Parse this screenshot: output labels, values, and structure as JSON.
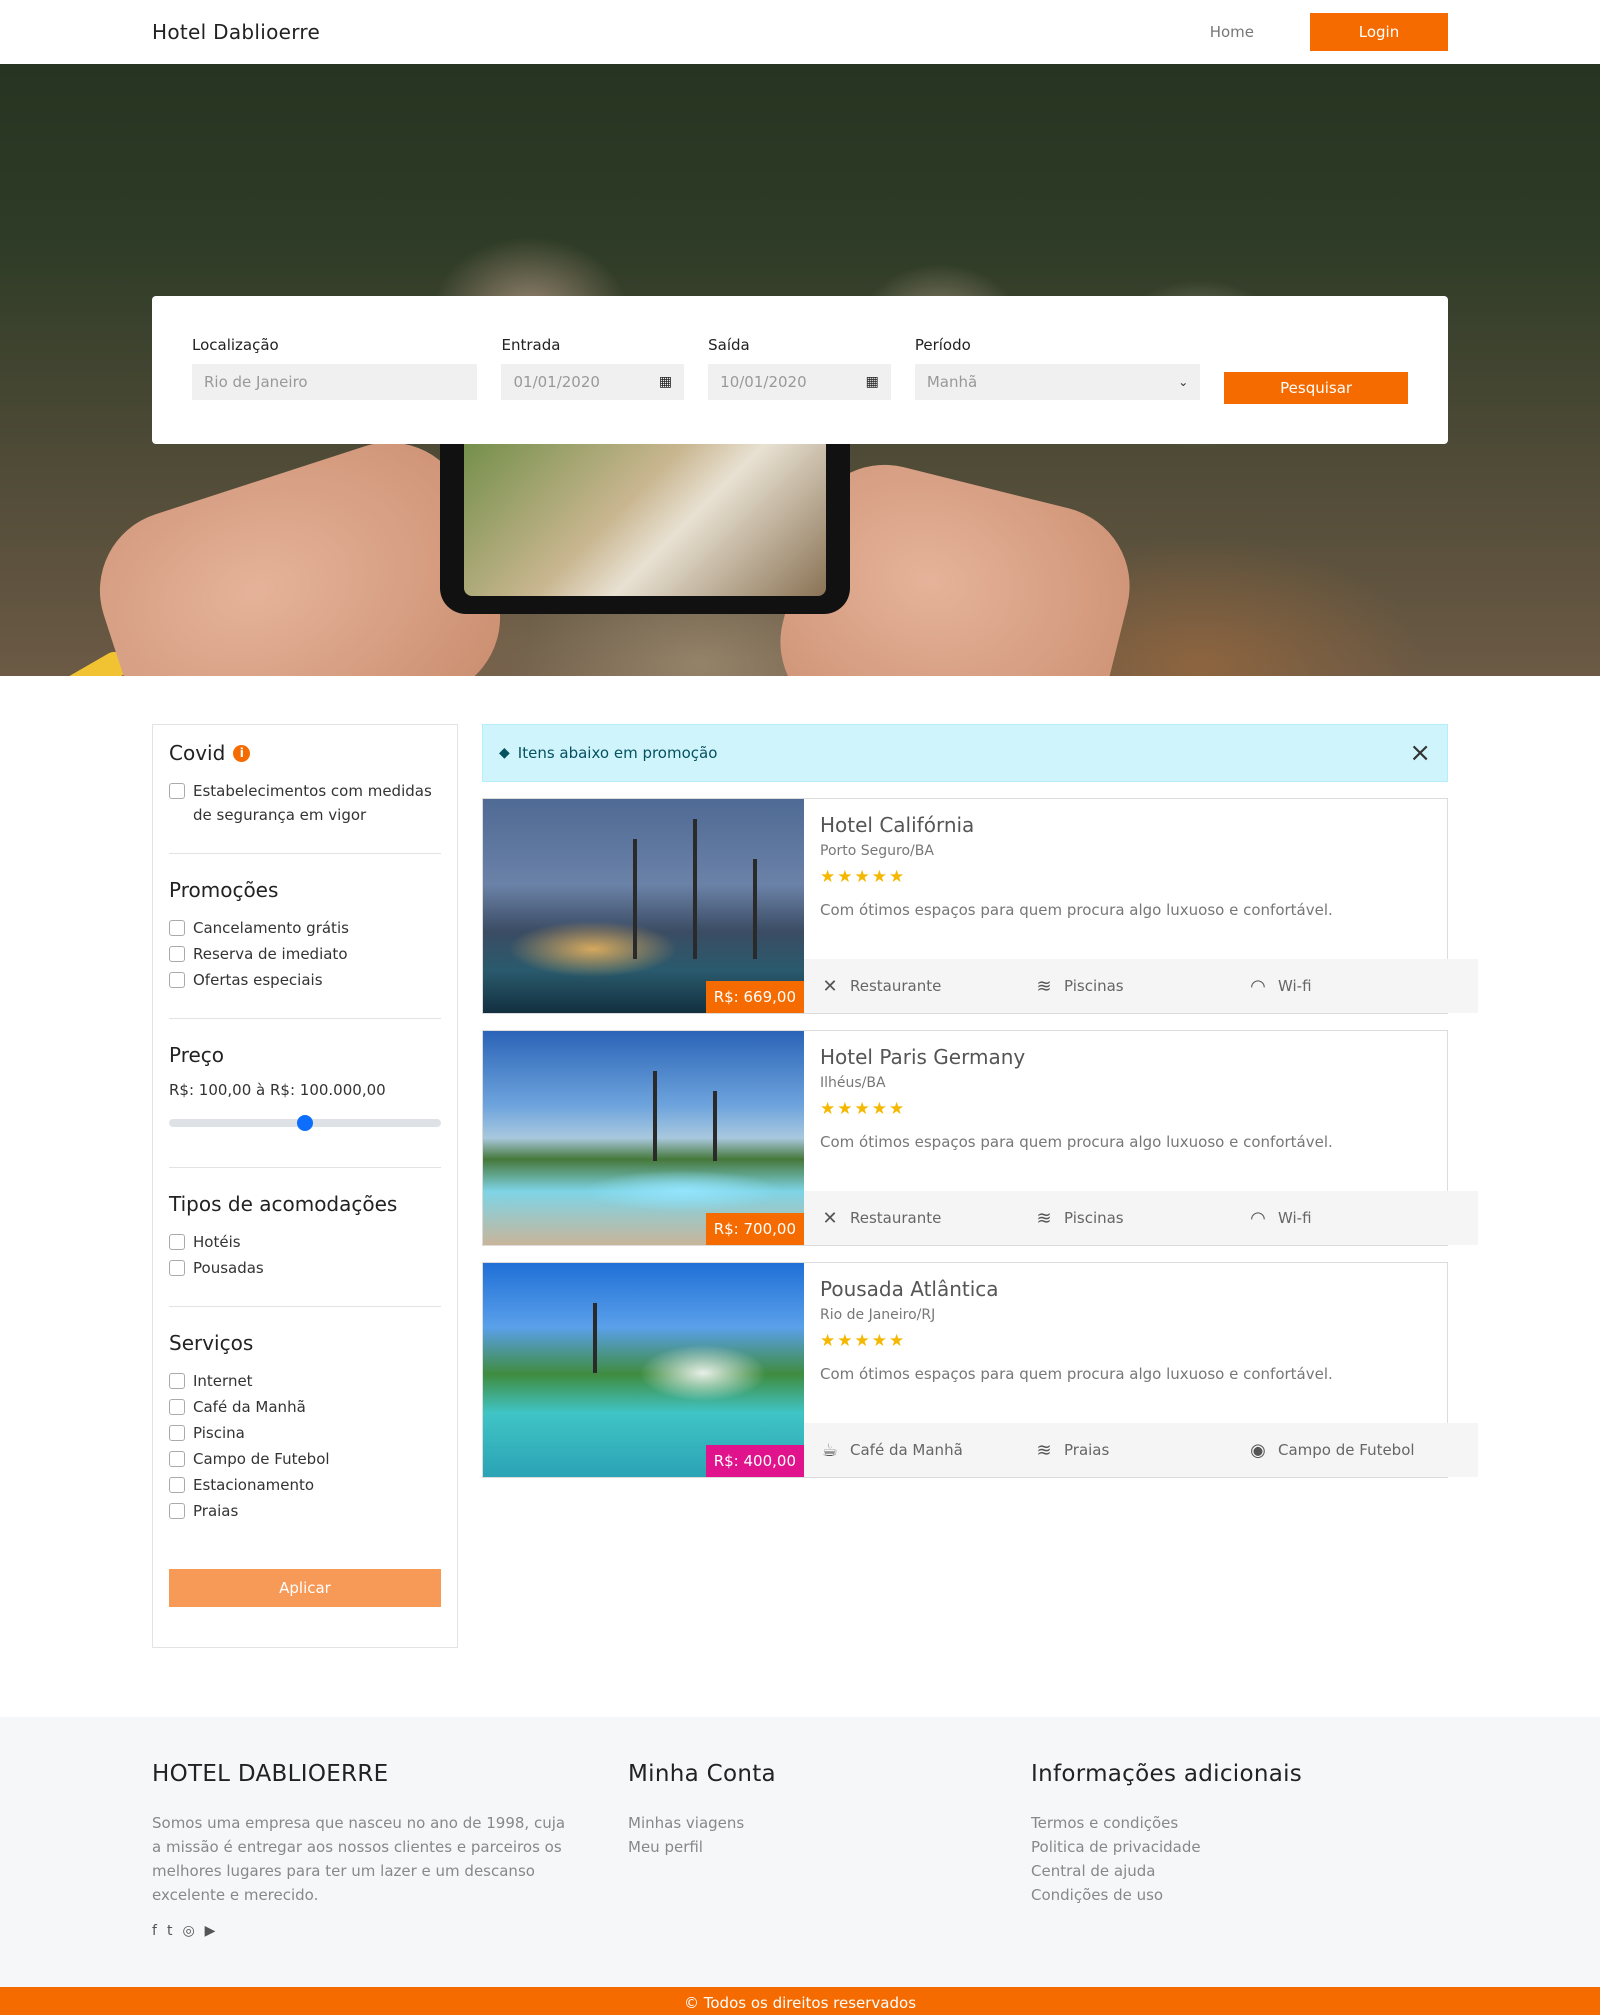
{
  "navbar": {
    "brand": "Hotel Dablioerre",
    "home": "Home",
    "login": "Login"
  },
  "search": {
    "location_label": "Localização",
    "location_placeholder": "Rio de Janeiro",
    "checkin_label": "Entrada",
    "checkin_value": "01/01/2020",
    "checkout_label": "Saída",
    "checkout_value": "10/01/2020",
    "period_label": "Período",
    "period_value": "Manhã",
    "button": "Pesquisar"
  },
  "filters": {
    "covid": {
      "title": "Covid",
      "options": [
        "Estabelecimentos com medidas de segurança em vigor"
      ]
    },
    "promotions": {
      "title": "Promoções",
      "options": [
        "Cancelamento grátis",
        "Reserva de imediato",
        "Ofertas especiais"
      ]
    },
    "price": {
      "title": "Preço",
      "range": "R$: 100,00 à R$: 100.000,00",
      "slider_level": 0.5
    },
    "types": {
      "title": "Tipos de acomodações",
      "options": [
        "Hotéis",
        "Pousadas"
      ]
    },
    "services": {
      "title": "Serviços",
      "options": [
        "Internet",
        "Café da Manhã",
        "Piscina",
        "Campo de Futebol",
        "Estacionamento",
        "Praias"
      ]
    },
    "apply": "Aplicar"
  },
  "alert": {
    "text": "Itens abaixo em promoção",
    "icon": "tag-icon",
    "close": "×"
  },
  "hotels": [
    {
      "name": "Hotel Califórnia",
      "location": "Porto Seguro/BA",
      "stars": "★★★★★",
      "description": "Com ótimos espaços para quem procura algo luxuoso e confortável.",
      "price": "R$: 669,00",
      "price_color": "#f56b00",
      "amenities": [
        {
          "icon": "utensils-icon",
          "glyph": "✕",
          "label": "Restaurante"
        },
        {
          "icon": "swimmer-icon",
          "glyph": "≋",
          "label": "Piscinas"
        },
        {
          "icon": "wifi-icon",
          "glyph": "◠",
          "label": "Wi-fi"
        }
      ]
    },
    {
      "name": "Hotel Paris Germany",
      "location": "Ilhéus/BA",
      "stars": "★★★★★",
      "description": "Com ótimos espaços para quem procura algo luxuoso e confortável.",
      "price": "R$: 700,00",
      "price_color": "#f56b00",
      "amenities": [
        {
          "icon": "utensils-icon",
          "glyph": "✕",
          "label": "Restaurante"
        },
        {
          "icon": "swimmer-icon",
          "glyph": "≋",
          "label": "Piscinas"
        },
        {
          "icon": "wifi-icon",
          "glyph": "◠",
          "label": "Wi-fi"
        }
      ]
    },
    {
      "name": "Pousada Atlântica",
      "location": "Rio de Janeiro/RJ",
      "stars": "★★★★★",
      "description": "Com ótimos espaços para quem procura algo luxuoso e confortável.",
      "price": "R$: 400,00",
      "price_color": "#e0128c",
      "amenities": [
        {
          "icon": "coffee-icon",
          "glyph": "☕",
          "label": "Café da Manhã"
        },
        {
          "icon": "swimmer-icon",
          "glyph": "≋",
          "label": "Praias"
        },
        {
          "icon": "football-icon",
          "glyph": "◉",
          "label": "Campo de Futebol"
        }
      ]
    }
  ],
  "footer": {
    "about_title": "HOTEL DABLIOERRE",
    "about_text": "Somos uma empresa que nasceu no ano de 1998, cuja a missão é entregar aos nossos clientes e parceiros os melhores lugares para ter um lazer e um descanso excelente e merecido.",
    "account_title": "Minha Conta",
    "account_links": [
      "Minhas viagens",
      "Meu perfil"
    ],
    "info_title": "Informações adicionais",
    "info_links": [
      "Termos e condições",
      "Politica de privacidade",
      "Central de ajuda",
      "Condições de uso"
    ],
    "socials": [
      {
        "icon": "facebook-icon",
        "glyph": "f"
      },
      {
        "icon": "twitter-icon",
        "glyph": "t"
      },
      {
        "icon": "instagram-icon",
        "glyph": "◎"
      },
      {
        "icon": "youtube-icon",
        "glyph": "▶"
      }
    ],
    "copyright": "© Todos os direitos reservados"
  },
  "colors": {
    "accent": "#f56b00",
    "apply_button": "#f79a58",
    "alert_bg": "#cff4fc",
    "star": "#f5b800"
  }
}
